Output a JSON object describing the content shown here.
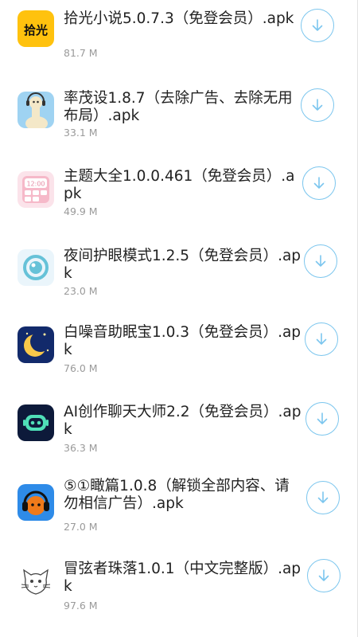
{
  "items": [
    {
      "name": "拾光小说5.0.7.3（免登会员）.apk",
      "size": "81.7 M",
      "icon": "shiguang-app-icon"
    },
    {
      "name": "率茂设1.8.7（去除广告、去除无用布局）.apk",
      "size": "33.1 M",
      "icon": "llama-app-icon"
    },
    {
      "name": "主题大全1.0.0.461（免登会员）.apk",
      "size": "49.9 M",
      "icon": "theme-app-icon"
    },
    {
      "name": "夜间护眼模式1.2.5（免登会员）.apk",
      "size": "23.0 M",
      "icon": "eye-care-app-icon"
    },
    {
      "name": "白噪音助眠宝1.0.3（免登会员）.apk",
      "size": "76.0 M",
      "icon": "moon-app-icon"
    },
    {
      "name": "AI创作聊天大师2.2（免登会员）.apk",
      "size": "36.3 M",
      "icon": "ai-robot-app-icon"
    },
    {
      "name": "⑤①瞰篇1.0.8（解锁全部内容、请勿相信广告）.apk",
      "size": "27.0 M",
      "icon": "headphone-app-icon"
    },
    {
      "name": "冒弦者珠落1.0.1（中文完整版）.apk",
      "size": "97.6 M",
      "icon": "sketch-cat-app-icon"
    }
  ],
  "icon_texts": {
    "shiguang": "拾光",
    "clock": "12:00"
  },
  "colors": {
    "accent": "#7cc6ee",
    "title": "#222222",
    "size": "#9a9a9a"
  }
}
